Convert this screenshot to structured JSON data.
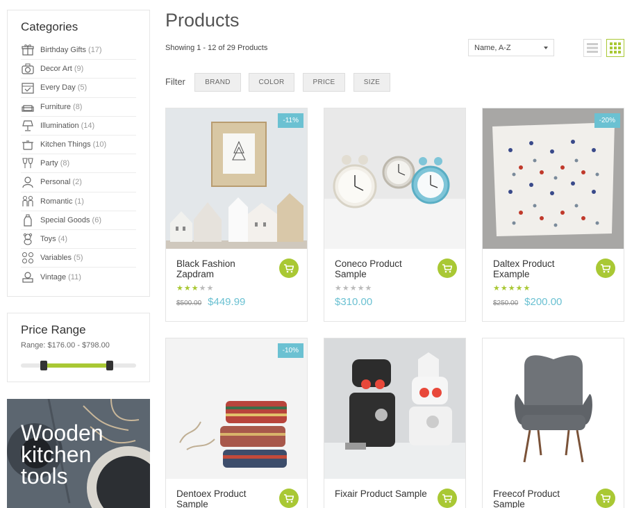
{
  "sidebar": {
    "categories_title": "Categories",
    "categories": [
      {
        "label": "Birthday Gifts",
        "count": "(17)",
        "icon": "gift-icon"
      },
      {
        "label": "Decor Art",
        "count": "(9)",
        "icon": "camera-icon"
      },
      {
        "label": "Every Day",
        "count": "(5)",
        "icon": "calendar-icon"
      },
      {
        "label": "Furniture",
        "count": "(8)",
        "icon": "sofa-icon"
      },
      {
        "label": "Illumination",
        "count": "(14)",
        "icon": "lamp-icon"
      },
      {
        "label": "Kitchen Things",
        "count": "(10)",
        "icon": "pot-icon"
      },
      {
        "label": "Party",
        "count": "(8)",
        "icon": "glasses-icon"
      },
      {
        "label": "Personal",
        "count": "(2)",
        "icon": "person-icon"
      },
      {
        "label": "Romantic",
        "count": "(1)",
        "icon": "couple-icon"
      },
      {
        "label": "Special Goods",
        "count": "(6)",
        "icon": "bottle-icon"
      },
      {
        "label": "Toys",
        "count": "(4)",
        "icon": "teddy-bear-icon"
      },
      {
        "label": "Variables",
        "count": "(5)",
        "icon": "dots-icon"
      },
      {
        "label": "Vintage",
        "count": "(11)",
        "icon": "gramophone-icon"
      }
    ],
    "price_range_title": "Price Range",
    "price_range_text": "Range: $176.00 - $798.00",
    "price_slider": {
      "min_fraction": 0.2,
      "max_fraction": 0.77
    },
    "promo_text": [
      "Wooden",
      "kitchen",
      "tools"
    ]
  },
  "main": {
    "title": "Products",
    "showing": "Showing 1 - 12 of 29 Products",
    "sort_value": "Name, A-Z",
    "filter_label": "Filter",
    "filters": [
      "BRAND",
      "COLOR",
      "PRICE",
      "SIZE"
    ],
    "accent": "#a9c834",
    "price_color": "#6bc1d2"
  },
  "products": [
    {
      "name": "Black Fashion Zapdram",
      "badge": "-11%",
      "rating": 3,
      "old_price": "$500.00",
      "price": "$449.99"
    },
    {
      "name": "Coneco Product Sample",
      "badge": "",
      "rating": 0,
      "old_price": "",
      "price": "$310.00"
    },
    {
      "name": "Daltex Product Example",
      "badge": "-20%",
      "rating": 5,
      "old_price": "$250.00",
      "price": "$200.00"
    },
    {
      "name": "Dentoex Product Sample",
      "badge": "-10%",
      "rating": 0,
      "old_price": "",
      "price": ""
    },
    {
      "name": "Fixair Product Sample",
      "badge": "",
      "rating": 0,
      "old_price": "",
      "price": ""
    },
    {
      "name": "Freecof Product Sample",
      "badge": "",
      "rating": 0,
      "old_price": "",
      "price": ""
    }
  ]
}
